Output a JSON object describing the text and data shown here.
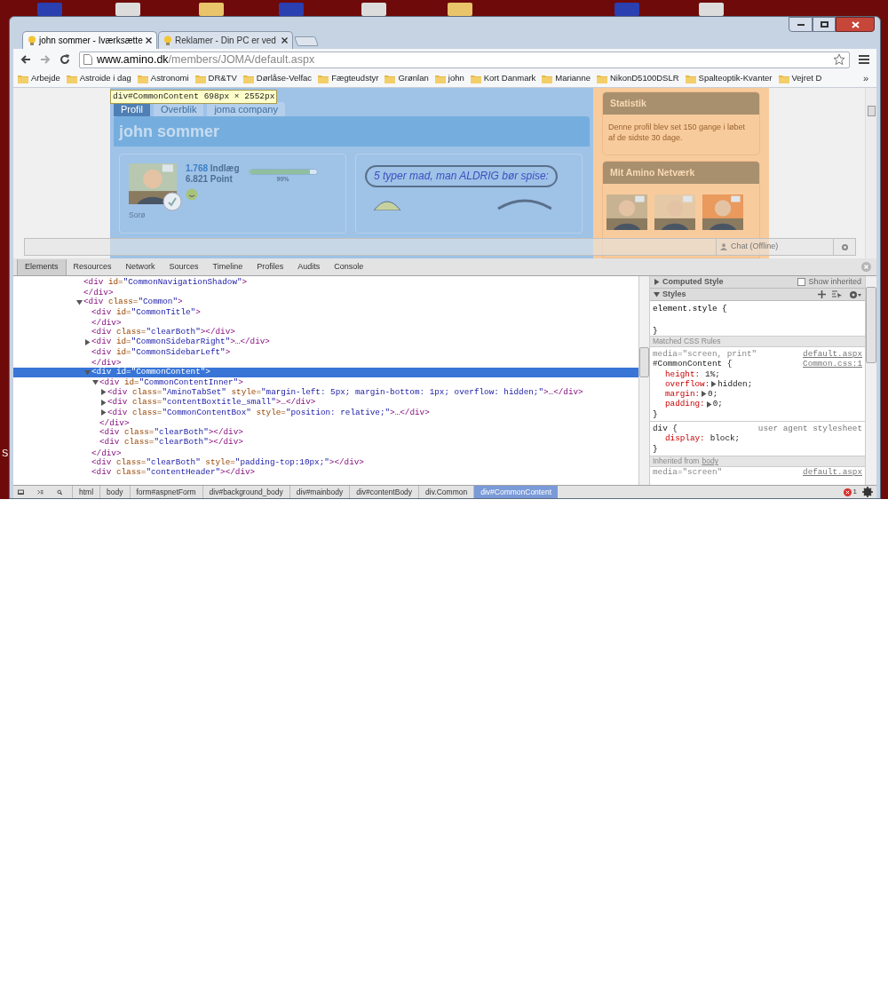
{
  "desktop": {
    "edge_label": "S"
  },
  "tabs": [
    {
      "title": "john sommer - Iværksætte",
      "selected": true
    },
    {
      "title": "Reklamer - Din PC er ved ",
      "selected": false
    }
  ],
  "address": {
    "host": "www.amino.dk",
    "path": "/members/JOMA/default.aspx"
  },
  "bookmarks": {
    "items": [
      "Arbejde",
      "Astroide i dag",
      "Astronomi",
      "DR&TV",
      "Dørlåse-Velfac",
      "Fægteudstyr",
      "Grønlan",
      "john",
      "Kort Danmark",
      "Marianne",
      "NikonD5100DSLR",
      "Spalteoptik-Kvanter",
      "Vejret D"
    ],
    "more": "»"
  },
  "page": {
    "inspect_tooltip": {
      "selector": "div#CommonContent",
      "size": "698px × 2552px"
    },
    "tabs": [
      {
        "label": "Profil",
        "selected": true
      },
      {
        "label": "Overblik",
        "selected": false
      },
      {
        "label": "joma company",
        "selected": false
      }
    ],
    "title": "john sommer",
    "profile": {
      "posts_count": "1.768",
      "posts_label": "Indlæg",
      "points": "6.821 Point",
      "level": 0.9,
      "percent": "90%",
      "location": "Sorø"
    },
    "banner": "5 typer mad, man ALDRIG bør spise:",
    "statistics": {
      "title": "Statistik",
      "text": "Denne profil blev set 150 gange i løbet af de sidste 30 dage."
    },
    "network": {
      "title": "Mit Amino Netværk"
    },
    "chat": "Chat (Offline)"
  },
  "devtools": {
    "tabs": [
      {
        "label": "Elements",
        "selected": true
      },
      {
        "label": "Resources",
        "selected": false
      },
      {
        "label": "Network",
        "selected": false
      },
      {
        "label": "Sources",
        "selected": false
      },
      {
        "label": "Timeline",
        "selected": false
      },
      {
        "label": "Profiles",
        "selected": false
      },
      {
        "label": "Audits",
        "selected": false
      },
      {
        "label": "Console",
        "selected": false
      }
    ],
    "dom": [
      {
        "open": "<div id=\"CommonNavigationShadow\">",
        "close": "</div>",
        "selected": false
      },
      {
        "open": "<div class=\"Common\">",
        "expanded": true,
        "selected": false,
        "children": [
          {
            "open": "<div id=\"CommonTitle\">",
            "close": "</div>",
            "selected": false
          },
          {
            "open": "<div class=\"clearBoth\"></div>",
            "selected": false
          },
          {
            "open": "<div id=\"CommonSidebarRight\">…</div>",
            "expanded": false,
            "selected": false
          },
          {
            "open": "<div id=\"CommonSidebarLeft\">",
            "close": "</div>",
            "selected": false
          },
          {
            "open": "<div id=\"CommonContent\">",
            "expanded": true,
            "selected": true,
            "close": "</div>",
            "children": [
              {
                "open": "<div id=\"CommonContentInner\">",
                "expanded": true,
                "selected": false,
                "close": "</div>",
                "children": [
                  {
                    "open": "<div class=\"AminoTabSet\" style=\"margin-left: 5px; margin-bottom: 1px; overflow: hidden;\">…</div>",
                    "expanded": false,
                    "selected": false
                  },
                  {
                    "open": "<div class=\"contentBoxtitle_small\">…</div>",
                    "expanded": false,
                    "selected": false
                  },
                  {
                    "open": "<div class=\"CommonContentBox\" style=\"position: relative;\">…</div>",
                    "expanded": false,
                    "selected": false
                  }
                ]
              },
              {
                "open": "<div class=\"clearBoth\"></div>",
                "selected": false
              },
              {
                "open": "<div class=\"clearBoth\"></div>",
                "selected": false
              }
            ]
          },
          {
            "open": "<div class=\"clearBoth\" style=\"padding-top:10px;\"></div>",
            "selected": false
          },
          {
            "open": "<div class=\"contentHeader\"></div>",
            "selected": false
          }
        ]
      }
    ],
    "breadcrumbs": [
      {
        "label": "html",
        "selected": false
      },
      {
        "label": "body",
        "selected": false
      },
      {
        "label": "form#aspnetForm",
        "selected": false
      },
      {
        "label": "div#background_body",
        "selected": false
      },
      {
        "label": "div#mainbody",
        "selected": false
      },
      {
        "label": "div#contentBody",
        "selected": false
      },
      {
        "label": "div.Common",
        "selected": false
      },
      {
        "label": "div#CommonContent",
        "selected": true
      }
    ],
    "sidebar": {
      "computed": {
        "title": "Computed Style",
        "expanded": false,
        "show_inherited": {
          "label": "Show inherited",
          "checked": false
        }
      },
      "styles": {
        "title": "Styles",
        "expanded": true
      },
      "element_style": {
        "open": "element.style {",
        "close": "}"
      },
      "matched_title": "Matched CSS Rules",
      "rules": [
        {
          "media": "media=\"screen, print\"",
          "media_source": "default.aspx",
          "selector": "#CommonContent {",
          "source": "Common.css:1",
          "props": [
            {
              "name": "height:",
              "value": "1%;",
              "expandable": false
            },
            {
              "name": "overflow:",
              "value": "hidden;",
              "expandable": true
            },
            {
              "name": "margin:",
              "value": "0;",
              "expandable": true
            },
            {
              "name": "padding:",
              "value": "0;",
              "expandable": true
            }
          ],
          "close": "}"
        },
        {
          "selector": "div {",
          "source": "user agent stylesheet",
          "props": [
            {
              "name": "display:",
              "value": "block;",
              "expandable": false
            }
          ],
          "close": "}"
        }
      ],
      "inherited": {
        "label": "Inherited from",
        "link": "body",
        "media": "media=\"screen\"",
        "media_source": "default.aspx"
      }
    },
    "error_count": "1"
  }
}
